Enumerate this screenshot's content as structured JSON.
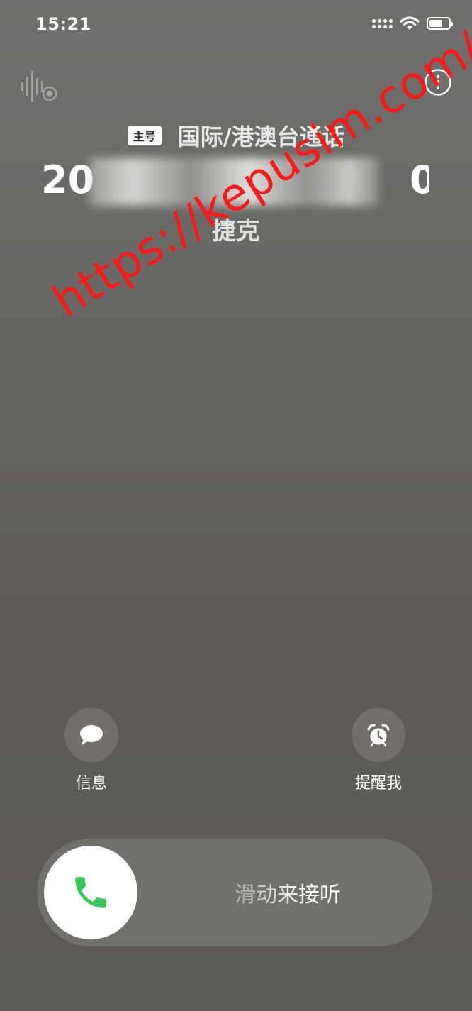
{
  "status_bar": {
    "time": "15:21",
    "battery_level": 0.7
  },
  "call": {
    "sim_badge": "主号",
    "call_type": "国际/港澳台通话",
    "number_visible_start": "20",
    "number_visible_end": "0",
    "location": "捷克"
  },
  "watermark": "https://kepusim.com/",
  "actions": {
    "message_label": "信息",
    "remind_label": "提醒我"
  },
  "slider": {
    "label": "滑动来接听"
  },
  "colors": {
    "answer_green": "#34c759",
    "watermark_red": "#ff1a1a"
  }
}
